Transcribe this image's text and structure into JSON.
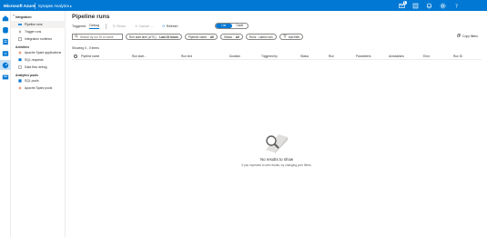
{
  "topbar": {
    "brand": "Microsoft Azure",
    "product": "Synapse Analytics",
    "notification_count": "1",
    "accent": "#0078d4",
    "icons": [
      "notification-icon",
      "settings-icon",
      "bell-icon",
      "help-icon",
      "feedback-icon"
    ]
  },
  "rail": {
    "icons": [
      "home-icon",
      "data-icon",
      "develop-icon",
      "integrate-icon",
      "monitor-icon",
      "manage-icon"
    ]
  },
  "nav": {
    "collapse_icon": "double-chevron-left-icon",
    "sections": [
      {
        "title": "Integration",
        "items": [
          "Pipeline runs",
          "Trigger runs",
          "Integration runtimes"
        ]
      },
      {
        "title": "Activities",
        "items": [
          "Apache Spark applications",
          "SQL requests",
          "Data flow debug"
        ]
      },
      {
        "title": "Analytics pools",
        "items": [
          "SQL pools",
          "Apache Spark pools"
        ]
      }
    ]
  },
  "main": {
    "title": "Pipeline runs",
    "tabs": [
      "Triggered",
      "Debug"
    ],
    "active_tab": "Debug",
    "actions": {
      "rerun": "Rerun",
      "cancel": "Cancel",
      "refresh": "Refresh"
    },
    "toggle": {
      "options": [
        "List",
        "Gantt"
      ],
      "selected": "List"
    },
    "search_placeholder": "Search by run ID or name",
    "filters": {
      "time": {
        "label": "Run start time (UTC) : ",
        "value": "Last 24 hours"
      },
      "pipeline": {
        "label": "Pipeline name : ",
        "value": "All"
      },
      "status": {
        "label": "Status : ",
        "value": "All"
      },
      "runs": "Runs : Latest runs",
      "add": "Add filter"
    },
    "copy_filters": "Copy filters",
    "showing": "Showing 0 - 0 items",
    "columns": [
      "Pipeline name",
      "Run start",
      "Run end",
      "Duration",
      "Triggered by",
      "Status",
      "Run",
      "Parameters",
      "Annotations",
      "Error",
      "Run ID"
    ],
    "empty_title": "No results to show",
    "empty_subtitle": "If you expected to see results, try changing your filters."
  }
}
